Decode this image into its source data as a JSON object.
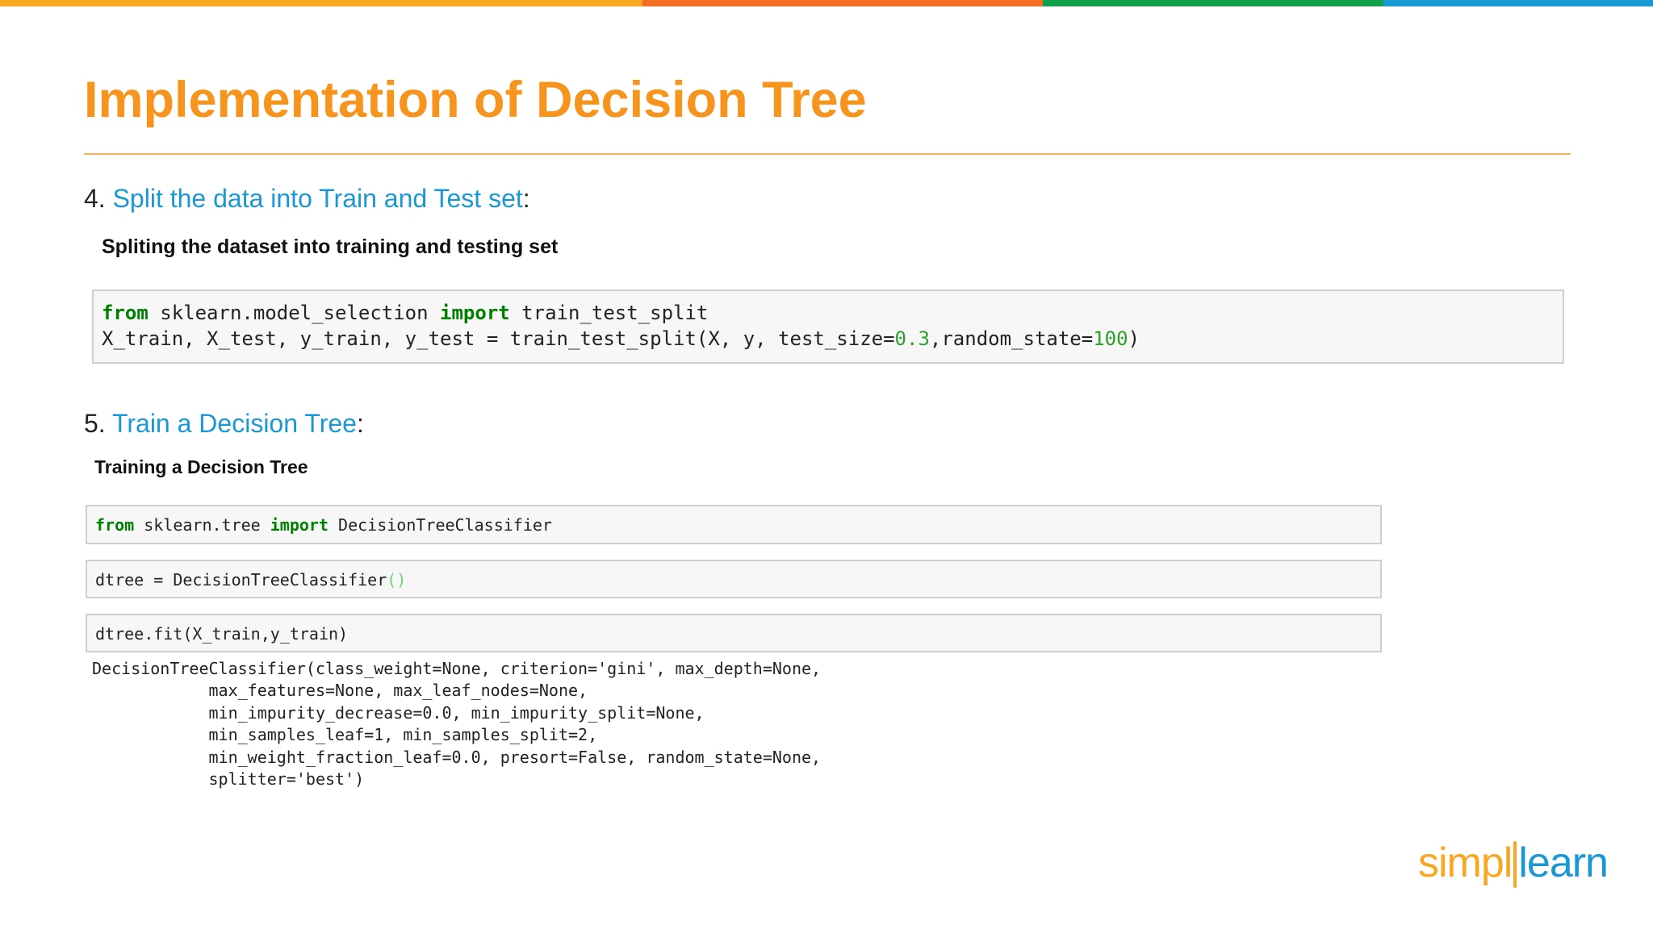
{
  "colors": {
    "bar_segments": [
      "#f7a823",
      "#f26f23",
      "#12a14a",
      "#1a98d4"
    ],
    "title": "#f7941d",
    "link": "#1a98d4",
    "keyword": "#008000"
  },
  "slide": {
    "title": "Implementation of Decision Tree"
  },
  "section4": {
    "number": "4. ",
    "heading": "Split the data into Train and Test set",
    "colon": ":",
    "subheading": "Spliting the dataset into training and testing set",
    "code": {
      "l1_kw1": "from",
      "l1_mod": " sklearn.model_selection ",
      "l1_kw2": "import",
      "l1_name": " train_test_split",
      "l2_pre": "X_train, X_test, y_train, y_test = train_test_split(X, y, test_size=",
      "l2_num1": "0.3",
      "l2_mid": ",random_state=",
      "l2_num2": "100",
      "l2_end": ")"
    }
  },
  "section5": {
    "number": "5. ",
    "heading": "Train a Decision Tree",
    "colon": ":",
    "subheading": "Training a Decision Tree",
    "cell1": {
      "kw1": "from",
      "mod": " sklearn.tree ",
      "kw2": "import",
      "name": " DecisionTreeClassifier"
    },
    "cell2": {
      "pre": "dtree = DecisionTreeClassifier",
      "parens": "()"
    },
    "cell3": {
      "code": "dtree.fit(X_train,y_train)"
    },
    "output": "DecisionTreeClassifier(class_weight=None, criterion='gini', max_depth=None,\n            max_features=None, max_leaf_nodes=None,\n            min_impurity_decrease=0.0, min_impurity_split=None,\n            min_samples_leaf=1, min_samples_split=2,\n            min_weight_fraction_leaf=0.0, presort=False, random_state=None,\n            splitter='best')"
  },
  "logo": {
    "part1": "simpl",
    "part2": "learn"
  }
}
